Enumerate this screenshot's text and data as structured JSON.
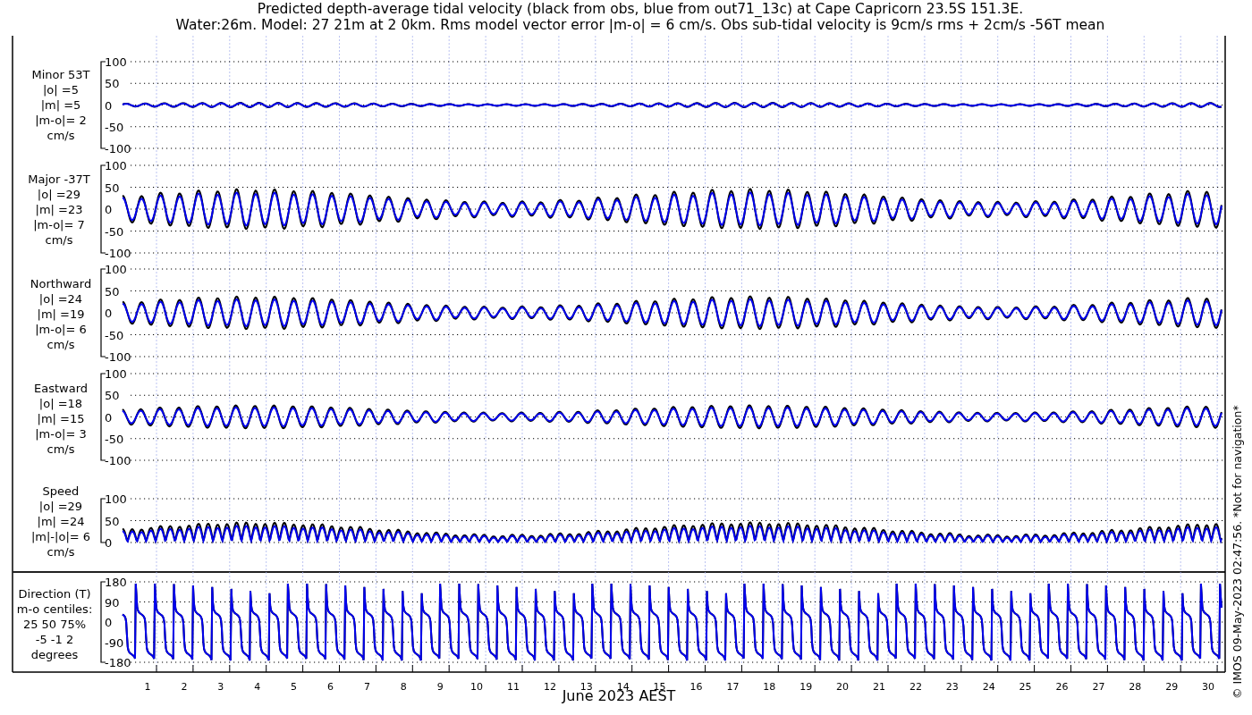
{
  "title": [
    "Predicted depth-average tidal velocity (black from obs, blue from out71_13c) at Cape Capricorn 23.5S 151.3E.",
    "Water:26m. Model: 27 21m at 2 0km. Rms model vector error |m-o| = 6 cm/s. Obs sub-tidal velocity is 9cm/s rms + 2cm/s -56T mean"
  ],
  "panels": [
    {
      "kind": "minor",
      "label": [
        "Minor 53T",
        "|o| =5",
        "|m| =5",
        "|m-o|= 2",
        "cm/s"
      ],
      "yticks": [
        "100",
        "50",
        "0",
        "-50",
        "-100"
      ]
    },
    {
      "kind": "major",
      "label": [
        "Major -37T",
        "|o| =29",
        "|m| =23",
        "|m-o|= 7",
        "cm/s"
      ],
      "yticks": [
        "100",
        "50",
        "0",
        "-50",
        "-100"
      ]
    },
    {
      "kind": "northward",
      "label": [
        "Northward",
        "|o| =24",
        "|m| =19",
        "|m-o|= 6",
        "cm/s"
      ],
      "yticks": [
        "100",
        "50",
        "0",
        "-50",
        "-100"
      ]
    },
    {
      "kind": "eastward",
      "label": [
        "Eastward",
        "|o| =18",
        "|m| =15",
        "|m-o|= 3",
        "cm/s"
      ],
      "yticks": [
        "100",
        "50",
        "0",
        "-50",
        "-100"
      ]
    },
    {
      "kind": "speed",
      "label": [
        "Speed",
        "|o| =29",
        "|m| =24",
        "|m|-|o|= 6",
        "cm/s"
      ],
      "yticks": [
        "100",
        "50",
        "0"
      ]
    },
    {
      "kind": "direction",
      "label": [
        "Direction (T)",
        "m-o centiles:",
        "25  50  75%",
        "-5 -1  2",
        "degrees"
      ],
      "yticks": [
        "180",
        "90",
        "0",
        "-90",
        "-180"
      ]
    }
  ],
  "days": [
    "1",
    "2",
    "3",
    "4",
    "5",
    "6",
    "7",
    "8",
    "9",
    "10",
    "11",
    "12",
    "13",
    "14",
    "15",
    "16",
    "17",
    "18",
    "19",
    "20",
    "21",
    "22",
    "23",
    "24",
    "25",
    "26",
    "27",
    "28",
    "29",
    "30"
  ],
  "xlabel": "June 2023 AEST",
  "credit": "© IMOS 09-May-2023 02:47:56.  *Not for navigation*"
}
